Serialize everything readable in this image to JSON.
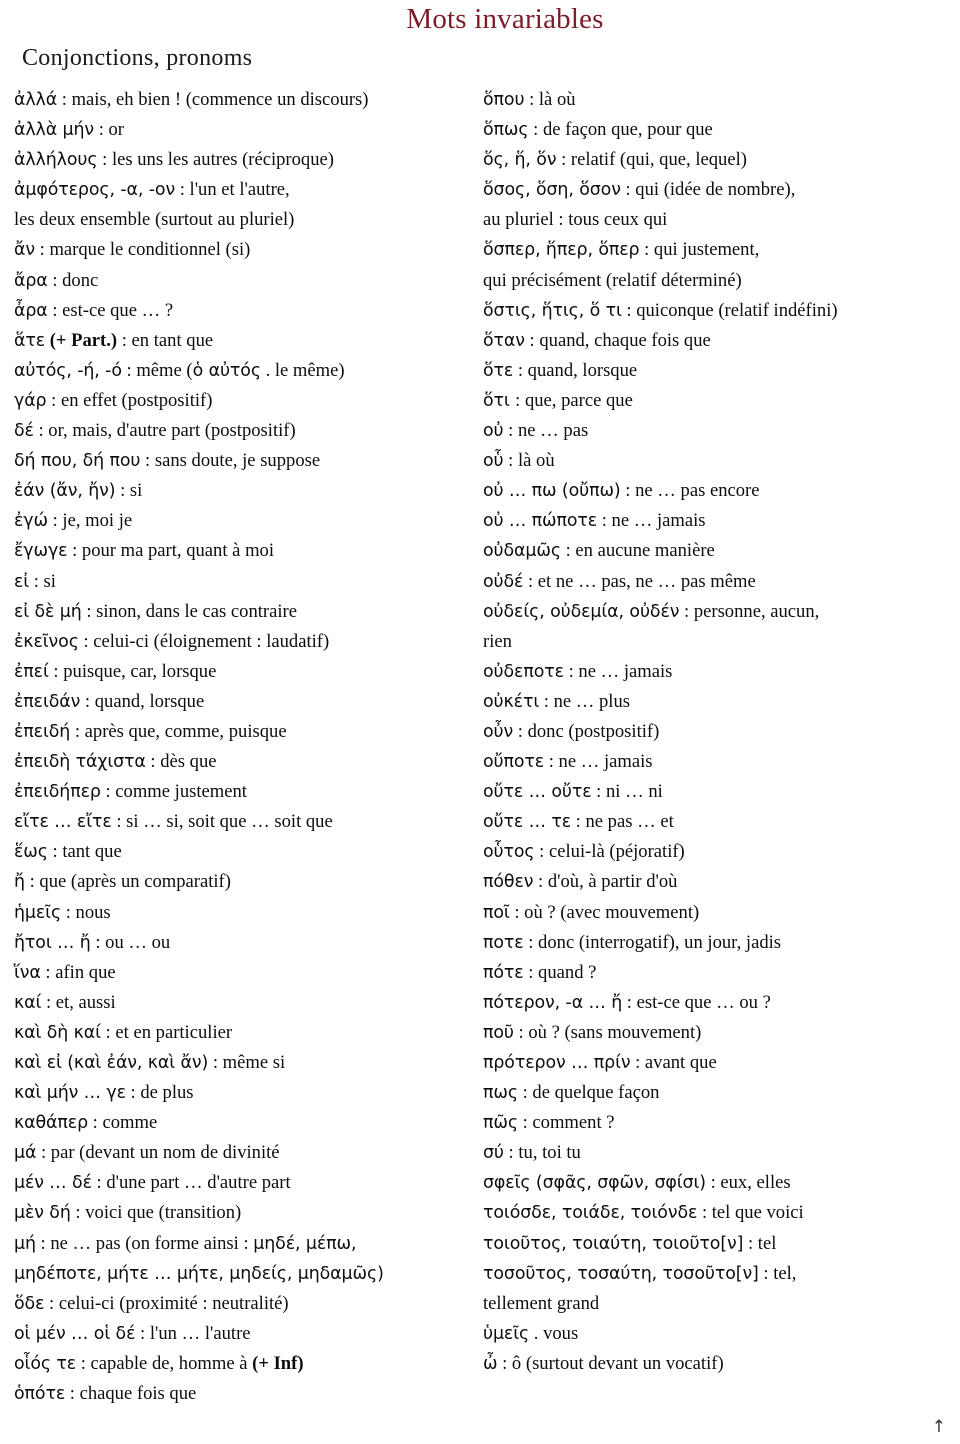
{
  "document": {
    "title": "Mots invariables",
    "title_color": "#7c1c28",
    "section_heading": "Conjonctions, pronoms",
    "back_to_top_icon": "up-arrow-icon",
    "back_to_top_glyph": "↑"
  },
  "columns": {
    "left": [
      {
        "greek": "ἀλλά",
        "french": " : mais, eh bien ! (commence un discours)"
      },
      {
        "greek": "ἀλλὰ μήν",
        "french": " : or"
      },
      {
        "greek": "ἀλλήλους",
        "french": " : les uns les autres (réciproque)"
      },
      {
        "greek": "ἀμφότερος, -α, -ον",
        "french": " : l'un et l'autre,"
      },
      {
        "greek": "",
        "french": "les deux ensemble (surtout au pluriel)"
      },
      {
        "greek": "ἄν",
        "french": " : marque le conditionnel (si)"
      },
      {
        "greek": "ἄρα",
        "french": " : donc"
      },
      {
        "greek": "ἆρα",
        "french": " : est-ce que … ?"
      },
      {
        "greek": "ἅτε",
        "french_pre": " ",
        "bold": "(+ Part.)",
        "french": " : en tant que"
      },
      {
        "greek": "αὐτός, -ή, -ό",
        "french": " : même (",
        "greek2": "ὁ αὐτός",
        "french2": " . le même)"
      },
      {
        "greek": "γάρ",
        "french": " : en effet (postpositif)"
      },
      {
        "greek": "δέ",
        "french": " : or, mais, d'autre part (postpositif)"
      },
      {
        "greek": "δή που, δή που",
        "french": " : sans doute, je suppose"
      },
      {
        "greek": "ἐάν (ἄν, ἤν)",
        "french": " : si"
      },
      {
        "greek": "ἐγώ",
        "french": " : je, moi je"
      },
      {
        "greek": "ἔγωγε",
        "french": " : pour ma part, quant à moi"
      },
      {
        "greek": "εἰ",
        "french": " : si"
      },
      {
        "greek": "εἰ δὲ μή",
        "french": " : sinon, dans le cas contraire"
      },
      {
        "greek": "ἐκεῖνος",
        "french": " : celui-ci (éloignement : laudatif)"
      },
      {
        "greek": "ἐπεί",
        "french": " : puisque, car, lorsque"
      },
      {
        "greek": "ἐπειδάν",
        "french": " : quand, lorsque"
      },
      {
        "greek": "ἐπειδή",
        "french": " : après que, comme, puisque"
      },
      {
        "greek": "ἐπειδὴ τάχιστα",
        "french": " : dès que"
      },
      {
        "greek": "ἐπειδήπερ",
        "french": " : comme justement"
      },
      {
        "greek": "εἴτε … εἴτε",
        "french": " : si … si, soit que … soit que"
      },
      {
        "greek": "ἕως",
        "french": " : tant que"
      },
      {
        "greek": "ἤ",
        "french": " : que (après un comparatif)"
      },
      {
        "greek": "ἡμεῖς",
        "french": " : nous"
      },
      {
        "greek": "ἤτοι … ἤ",
        "french": " : ou … ou"
      },
      {
        "greek": "ἵνα",
        "french": " : afin que"
      },
      {
        "greek": "καί",
        "french": " : et, aussi"
      },
      {
        "greek": "καὶ δὴ καί",
        "french": " : et en particulier"
      },
      {
        "greek": "καὶ εἰ (καὶ ἐάν, καὶ ἄν)",
        "french": " : même si"
      },
      {
        "greek": "καὶ μήν … γε",
        "french": " : de plus"
      },
      {
        "greek": "καθάπερ",
        "french": " : comme"
      },
      {
        "greek": "μά",
        "french": " : par (devant un nom de divinité"
      },
      {
        "greek": "μέν … δέ",
        "french": " : d'une part … d'autre part"
      },
      {
        "greek": "μὲν δή",
        "french": " : voici que (transition)"
      },
      {
        "greek": "μή",
        "french": " : ne … pas (on forme ainsi : ",
        "greek2": "μηδέ, μέπω,",
        "french2": ""
      },
      {
        "greek": "μηδέποτε, μήτε … μήτε, μηδείς, μηδαμῶς)",
        "french": ""
      },
      {
        "greek": "ὅδε",
        "french": " : celui-ci (proximité : neutralité)"
      },
      {
        "greek": "οἱ μέν  … οἱ δέ",
        "french": " : l'un … l'autre"
      },
      {
        "greek": "οἷός τε",
        "french": " : capable de, homme à ",
        "bold": "(+ Inf)"
      },
      {
        "greek": "ὁπότε",
        "french": " : chaque fois que"
      }
    ],
    "right": [
      {
        "greek": "ὅπου",
        "french": " : là où"
      },
      {
        "greek": "ὅπως",
        "french": " : de façon que, pour que"
      },
      {
        "greek": "ὅς, ἥ, ὅν",
        "french": " : relatif (qui, que, lequel)"
      },
      {
        "greek": "ὅσος, ὅση, ὅσον",
        "french": " : qui (idée de nombre),"
      },
      {
        "greek": "",
        "french": "au pluriel : tous ceux qui"
      },
      {
        "greek": "ὅσπερ, ἥπερ, ὅπερ",
        "french": " : qui justement,"
      },
      {
        "greek": "",
        "french": "qui précisément (relatif déterminé)"
      },
      {
        "greek": "ὅστις, ἥτις, ὅ τι",
        "french": " : quiconque (relatif indéfini)"
      },
      {
        "greek": "ὅταν",
        "french": " : quand, chaque fois que"
      },
      {
        "greek": "ὅτε",
        "french": " : quand, lorsque"
      },
      {
        "greek": "ὅτι ",
        "french": " : que, parce que"
      },
      {
        "greek": "οὐ",
        "french": " : ne … pas"
      },
      {
        "greek": "οὗ",
        "french": " : là où"
      },
      {
        "greek": "οὐ … πω (οὔπω)",
        "french": " : ne … pas encore"
      },
      {
        "greek": "οὐ … πώποτε",
        "french": " : ne … jamais"
      },
      {
        "greek": "οὐδαμῶς",
        "french": " : en aucune manière"
      },
      {
        "greek": "οὐδέ",
        "french": " : et ne … pas, ne … pas même"
      },
      {
        "greek": "οὐδείς, οὐδεμία, οὐδέν",
        "french": " : personne, aucun,"
      },
      {
        "greek": "",
        "french": "rien"
      },
      {
        "greek": "οὐδεποτε",
        "french": " : ne … jamais"
      },
      {
        "greek": "οὐκέτι",
        "french": " : ne … plus"
      },
      {
        "greek": "οὖν",
        "french": " : donc (postpositif)"
      },
      {
        "greek": "οὔποτε",
        "french": " : ne … jamais"
      },
      {
        "greek": "οὔτε … οὔτε",
        "french": " : ni … ni"
      },
      {
        "greek": "οὔτε … τε",
        "french": " : ne pas … et"
      },
      {
        "greek": "οὗτος",
        "french": " : celui-là (péjoratif)"
      },
      {
        "greek": "πόθεν",
        "french": " : d'où, à partir d'où"
      },
      {
        "greek": "ποῖ",
        "french": " : où ? (avec mouvement)"
      },
      {
        "greek": "ποτε",
        "french": " : donc (interrogatif), un jour, jadis"
      },
      {
        "greek": "πότε",
        "french": " : quand ?"
      },
      {
        "greek": "πότερον, -α … ἤ",
        "french": " : est-ce que … ou ?"
      },
      {
        "greek": "ποῦ",
        "french": " : où ? (sans mouvement)"
      },
      {
        "greek": "πρότερον … πρίν",
        "french": " : avant que"
      },
      {
        "greek": "πως",
        "french": " : de quelque façon"
      },
      {
        "greek": "πῶς",
        "french": " : comment ?"
      },
      {
        "greek": "σύ",
        "french": " : tu, toi tu"
      },
      {
        "greek": "σφεῖς (σφᾶς, σφῶν, σφίσι)",
        "french": " : eux, elles"
      },
      {
        "greek": "τοιόσδε, τοιάδε, τοιόνδε",
        "french": " : tel que voici"
      },
      {
        "greek": "τοιοῦτος, τοιαύτη, τοιοῦτο[ν]",
        "french": " : tel"
      },
      {
        "greek": "τοσοῦτος, τοσαύτη, τοσοῦτο[ν]",
        "french": " : tel,"
      },
      {
        "greek": "",
        "french": "tellement grand"
      },
      {
        "greek": "ὑμεῖς",
        "french": " . vous"
      },
      {
        "greek": "ὦ",
        "french": " : ô (surtout devant un vocatif)"
      }
    ]
  }
}
